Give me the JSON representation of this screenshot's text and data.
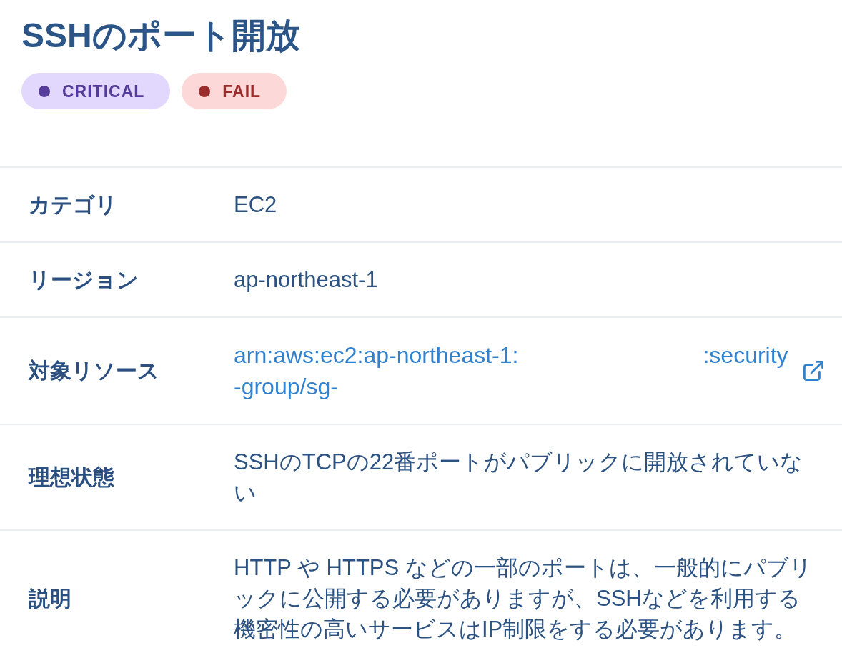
{
  "title": "SSHのポート開放",
  "badges": [
    {
      "label": "CRITICAL",
      "color": "#553c9a"
    },
    {
      "label": "FAIL",
      "color": "#9b2c2c"
    }
  ],
  "details": [
    {
      "kind": "text",
      "label": "カテゴリ",
      "value": "EC2"
    },
    {
      "kind": "text",
      "label": "リージョン",
      "value": "ap-northeast-1"
    },
    {
      "kind": "link",
      "label": "対象リソース",
      "value_parts": [
        "arn:aws:ec2:ap-northeast-1:",
        ":security-group/sg-"
      ]
    },
    {
      "kind": "text",
      "label": "理想状態",
      "value": "SSHのTCPの22番ポートがパブリックに開放されていない"
    },
    {
      "kind": "text",
      "label": "説明",
      "value": "HTTP や HTTPS などの一部のポートは、一般的にパブリックに公開する必要がありますが、SSHなどを利用する機密性の高いサービスはIP制限をする必要があります。"
    }
  ]
}
